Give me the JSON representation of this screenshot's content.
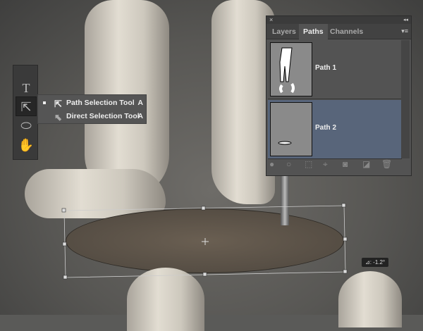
{
  "tools": [
    {
      "name": "type-tool",
      "glyph": "T"
    },
    {
      "name": "path-selection-tool",
      "glyph": "⇱"
    },
    {
      "name": "ellipse-tool",
      "glyph": "⬭"
    },
    {
      "name": "hand-tool",
      "glyph": "✋"
    }
  ],
  "flyout": {
    "items": [
      {
        "label": "Path Selection Tool",
        "shortcut": "A",
        "selected": true
      },
      {
        "label": "Direct Selection Tool",
        "shortcut": "A",
        "selected": false
      }
    ]
  },
  "panel": {
    "close": "×",
    "collapse": "◂◂",
    "menu": "▾≡",
    "tabs": [
      "Layers",
      "Paths",
      "Channels"
    ],
    "active_tab": "Paths",
    "paths": [
      {
        "name": "Path 1"
      },
      {
        "name": "Path 2",
        "selected": true
      }
    ],
    "selected_color": "#58657a"
  },
  "angle_readout": "⊿: -1.2°"
}
